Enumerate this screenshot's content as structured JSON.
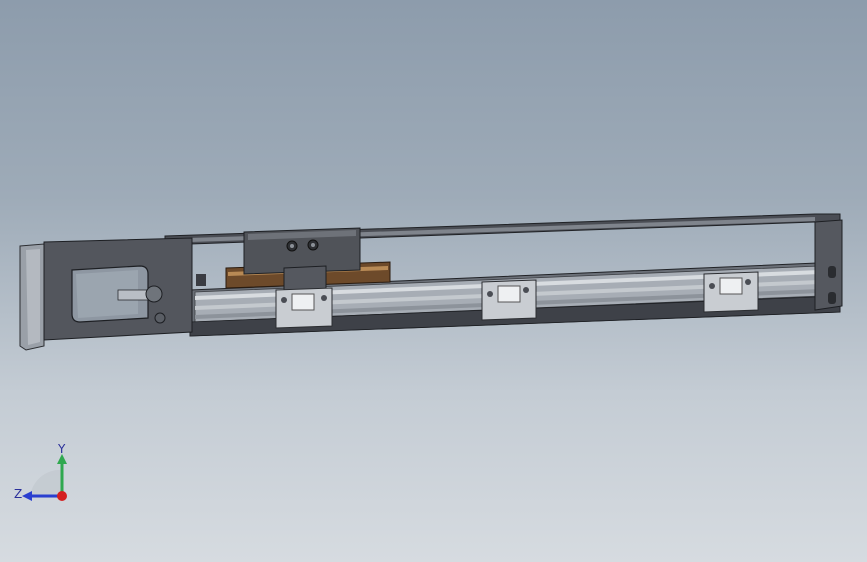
{
  "viewport": {
    "background_top": "#8d9cac",
    "background_bottom": "#d6dbe0"
  },
  "triad": {
    "y_label": "Y",
    "z_label": "Z",
    "colors": {
      "y": "#2fa84f",
      "z": "#2a3fd0",
      "x": "#d42020"
    }
  },
  "model": {
    "description_icon": "linear-actuator-model"
  }
}
